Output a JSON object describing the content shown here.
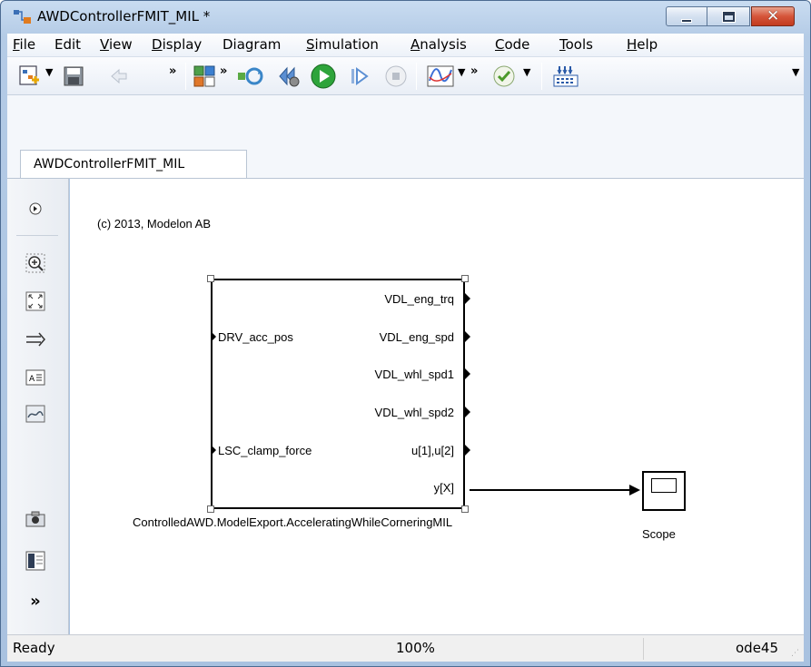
{
  "window": {
    "title": "AWDControllerFMIT_MIL *"
  },
  "menu": {
    "items": [
      {
        "mnemonic": "F",
        "rest": "ile"
      },
      {
        "mnemonic": "",
        "rest": "Edit"
      },
      {
        "mnemonic": "V",
        "rest": "iew"
      },
      {
        "mnemonic": "D",
        "rest": "isplay"
      },
      {
        "mnemonic": "",
        "rest": "Diagram"
      },
      {
        "mnemonic": "S",
        "rest": "imulation"
      },
      {
        "mnemonic": "A",
        "rest": "nalysis"
      },
      {
        "mnemonic": "C",
        "rest": "ode"
      },
      {
        "mnemonic": "T",
        "rest": "ools"
      },
      {
        "mnemonic": "H",
        "rest": "elp"
      }
    ]
  },
  "toolbar": {
    "more": "»"
  },
  "tabs": [
    {
      "label": "AWDControllerFMIT_MIL"
    }
  ],
  "palette": {
    "expand": "»"
  },
  "canvas": {
    "copyright": "(c) 2013, Modelon AB",
    "block": {
      "name": "ControlledAWD.ModelExport.AcceleratingWhileCorneringMIL",
      "inputs": [
        "DRV_acc_pos",
        "LSC_clamp_force"
      ],
      "outputs": [
        "VDL_eng_trq",
        "VDL_eng_spd",
        "VDL_whl_spd1",
        "VDL_whl_spd2",
        "u[1],u[2]",
        "y[X]"
      ]
    },
    "scope": {
      "label": "Scope"
    }
  },
  "status": {
    "state": "Ready",
    "zoom": "100%",
    "solver": "ode45"
  }
}
